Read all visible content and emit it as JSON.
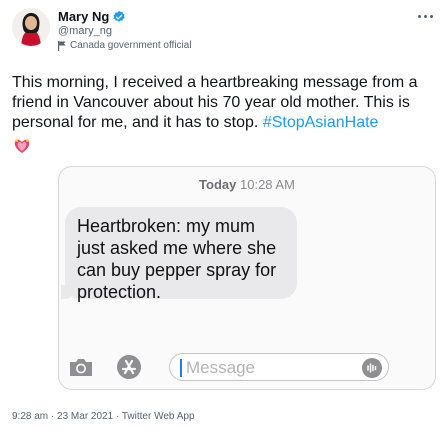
{
  "author": {
    "name": "Mary Ng",
    "handle": "@mary_ng",
    "account_label": "Canada government official"
  },
  "tweet": {
    "text_main": "This morning, I received a heartbreaking message from a friend in Vancouver about his 70 year old mother. This is personal for me, and it has to stop. ",
    "hashtag": "#StopAsianHate",
    "footer": "9:28 am · 23 Mar 2021 · Twitter Web App"
  },
  "media": {
    "timestamp_day": "Today",
    "timestamp_time": "10:28 AM",
    "message": "Heartbroken: my mum just asked me where she can buy pepper spray for protection.",
    "composer_placeholder": "Message"
  },
  "icons": {
    "verified": "verified-badge-icon",
    "label": "flag-icon",
    "emoji": "heart-flower-emoji-icon",
    "camera": "camera-icon",
    "appstore": "app-store-icon",
    "audio": "audio-waveform-icon",
    "more": "more-options-icon"
  },
  "colors": {
    "accent": "#1d9bf0",
    "text": "#0f1419",
    "muted": "#536471",
    "bubble": "#e9e9eb"
  }
}
